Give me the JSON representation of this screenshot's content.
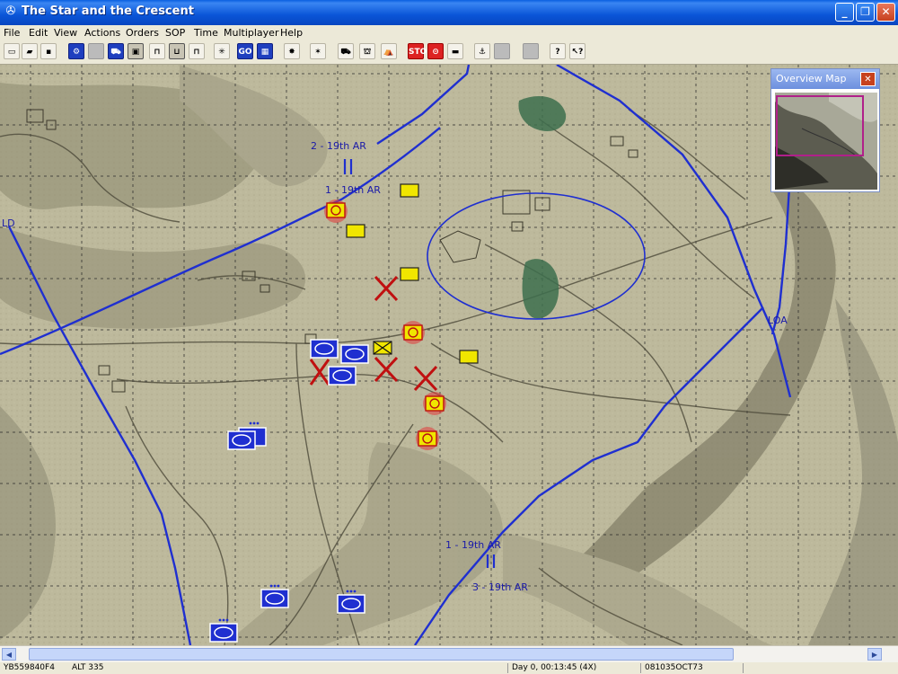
{
  "window": {
    "title": "The Star and the Crescent"
  },
  "menu": [
    "File",
    "Edit",
    "View",
    "Actions",
    "Orders",
    "SOP",
    "Time",
    "Multiplayer",
    "Help"
  ],
  "toolbar": {
    "go_label": "GO",
    "stop_label": "STOP"
  },
  "map": {
    "labels": {
      "ld": "LD",
      "loa": "LOA",
      "unit_2_19th": "2 - 19th AR",
      "unit_1_19th_top": "1 - 19th AR",
      "unit_1_19th_bottom": "1 - 19th AR",
      "unit_3_19th": "3 - 19th AR"
    }
  },
  "overview": {
    "title": "Overview Map"
  },
  "status": {
    "coords": "YB559840F4",
    "alt": "ALT 335",
    "time": "Day 0, 00:13:45 (4X)",
    "datetime": "081035OCT73"
  },
  "colors": {
    "friendly": "#1f2fd0",
    "enemy": "#cc1111",
    "sighted": "#e8e000",
    "map": "#bdb99c"
  }
}
